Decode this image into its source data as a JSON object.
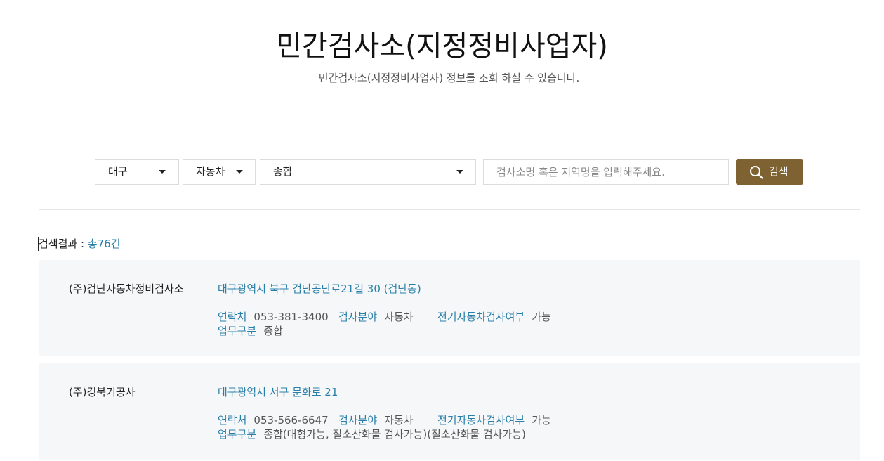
{
  "header": {
    "title": "민간검사소(지정정비사업자)",
    "subtitle": "민간검사소(지정정비사업자) 정보를 조회 하실 수 있습니다."
  },
  "search": {
    "region": "대구",
    "vehicle_type": "자동차",
    "business_type": "종합",
    "placeholder": "검사소명 혹은 지역명을 입력해주세요.",
    "button_label": "검색"
  },
  "results": {
    "label": "검색결과 : ",
    "count": "총76건"
  },
  "labels": {
    "contact": "연락처",
    "field": "검사분야",
    "ev": "전기자동차검사여부",
    "business": "업무구분"
  },
  "stations": [
    {
      "name": "(주)검단자동차정비검사소",
      "address": "대구광역시 북구 검단공단로21길 30 (검단동)",
      "contact": "053-381-3400",
      "field": "자동차",
      "ev": "가능",
      "business": "종합"
    },
    {
      "name": "(주)경북기공사",
      "address": "대구광역시 서구 문화로 21",
      "contact": "053-566-6647",
      "field": "자동차",
      "ev": "가능",
      "business": "종합(대형가능, 질소산화물 검사가능)(질소산화물 검사가능)"
    }
  ],
  "colors": {
    "accent": "#7f6232",
    "link": "#2a7fa8",
    "card_bg": "#f5f7f9"
  }
}
